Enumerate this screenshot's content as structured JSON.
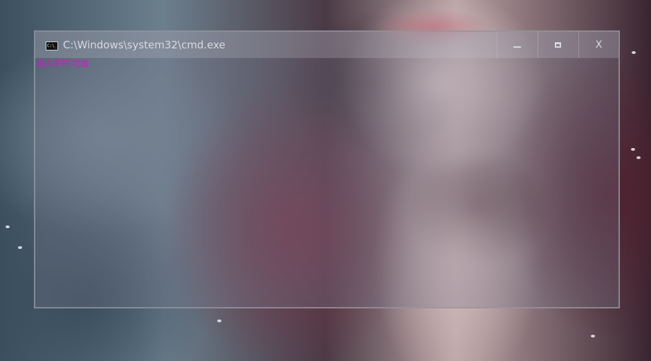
{
  "window": {
    "title": "C:\\Windows\\system32\\cmd.exe",
    "icon_text": "C:\\_",
    "controls": {
      "minimize": "minimize",
      "maximize": "maximize",
      "close": "X"
    }
  },
  "console": {
    "lines": [
      "输入字符:吃饭"
    ],
    "text_color": "#c81ec8"
  },
  "colors": {
    "window_border": "#96969f",
    "title_text": "#d9d9de"
  }
}
